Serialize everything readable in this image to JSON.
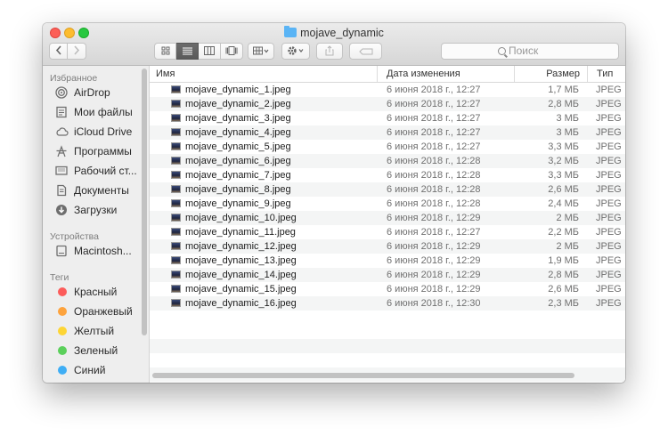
{
  "window": {
    "title": "mojave_dynamic"
  },
  "toolbar": {
    "back_icon": "chevron-left-icon",
    "forward_icon": "chevron-right-icon",
    "view_modes": [
      "icon-view",
      "list-view",
      "column-view",
      "gallery-view"
    ],
    "active_view": "list-view",
    "search_placeholder": "Поиск"
  },
  "sidebar": {
    "favorites_header": "Избранное",
    "favorites": [
      {
        "label": "AirDrop",
        "icon": "airdrop-icon"
      },
      {
        "label": "Мои файлы",
        "icon": "all-files-icon"
      },
      {
        "label": "iCloud Drive",
        "icon": "cloud-icon"
      },
      {
        "label": "Программы",
        "icon": "applications-icon"
      },
      {
        "label": "Рабочий ст...",
        "icon": "desktop-icon"
      },
      {
        "label": "Документы",
        "icon": "documents-icon"
      },
      {
        "label": "Загрузки",
        "icon": "downloads-icon"
      }
    ],
    "devices_header": "Устройства",
    "devices": [
      {
        "label": "Macintosh...",
        "icon": "hard-drive-icon"
      }
    ],
    "tags_header": "Теги",
    "tags": [
      {
        "label": "Красный",
        "color": "#fc5c5a"
      },
      {
        "label": "Оранжевый",
        "color": "#fda33d"
      },
      {
        "label": "Желтый",
        "color": "#fdd535"
      },
      {
        "label": "Зеленый",
        "color": "#5bd05b"
      },
      {
        "label": "Синий",
        "color": "#3faef5"
      }
    ]
  },
  "list": {
    "columns": {
      "name": "Имя",
      "date": "Дата изменения",
      "size": "Размер",
      "kind": "Тип"
    },
    "rows": [
      {
        "name": "mojave_dynamic_1.jpeg",
        "date": "6 июня 2018 г., 12:27",
        "size": "1,7 МБ",
        "kind": "JPEG"
      },
      {
        "name": "mojave_dynamic_2.jpeg",
        "date": "6 июня 2018 г., 12:27",
        "size": "2,8 МБ",
        "kind": "JPEG"
      },
      {
        "name": "mojave_dynamic_3.jpeg",
        "date": "6 июня 2018 г., 12:27",
        "size": "3 МБ",
        "kind": "JPEG"
      },
      {
        "name": "mojave_dynamic_4.jpeg",
        "date": "6 июня 2018 г., 12:27",
        "size": "3 МБ",
        "kind": "JPEG"
      },
      {
        "name": "mojave_dynamic_5.jpeg",
        "date": "6 июня 2018 г., 12:27",
        "size": "3,3 МБ",
        "kind": "JPEG"
      },
      {
        "name": "mojave_dynamic_6.jpeg",
        "date": "6 июня 2018 г., 12:28",
        "size": "3,2 МБ",
        "kind": "JPEG"
      },
      {
        "name": "mojave_dynamic_7.jpeg",
        "date": "6 июня 2018 г., 12:28",
        "size": "3,3 МБ",
        "kind": "JPEG"
      },
      {
        "name": "mojave_dynamic_8.jpeg",
        "date": "6 июня 2018 г., 12:28",
        "size": "2,6 МБ",
        "kind": "JPEG"
      },
      {
        "name": "mojave_dynamic_9.jpeg",
        "date": "6 июня 2018 г., 12:28",
        "size": "2,4 МБ",
        "kind": "JPEG"
      },
      {
        "name": "mojave_dynamic_10.jpeg",
        "date": "6 июня 2018 г., 12:29",
        "size": "2 МБ",
        "kind": "JPEG"
      },
      {
        "name": "mojave_dynamic_11.jpeg",
        "date": "6 июня 2018 г., 12:27",
        "size": "2,2 МБ",
        "kind": "JPEG"
      },
      {
        "name": "mojave_dynamic_12.jpeg",
        "date": "6 июня 2018 г., 12:29",
        "size": "2 МБ",
        "kind": "JPEG"
      },
      {
        "name": "mojave_dynamic_13.jpeg",
        "date": "6 июня 2018 г., 12:29",
        "size": "1,9 МБ",
        "kind": "JPEG"
      },
      {
        "name": "mojave_dynamic_14.jpeg",
        "date": "6 июня 2018 г., 12:29",
        "size": "2,8 МБ",
        "kind": "JPEG"
      },
      {
        "name": "mojave_dynamic_15.jpeg",
        "date": "6 июня 2018 г., 12:29",
        "size": "2,6 МБ",
        "kind": "JPEG"
      },
      {
        "name": "mojave_dynamic_16.jpeg",
        "date": "6 июня 2018 г., 12:30",
        "size": "2,3 МБ",
        "kind": "JPEG"
      }
    ]
  }
}
